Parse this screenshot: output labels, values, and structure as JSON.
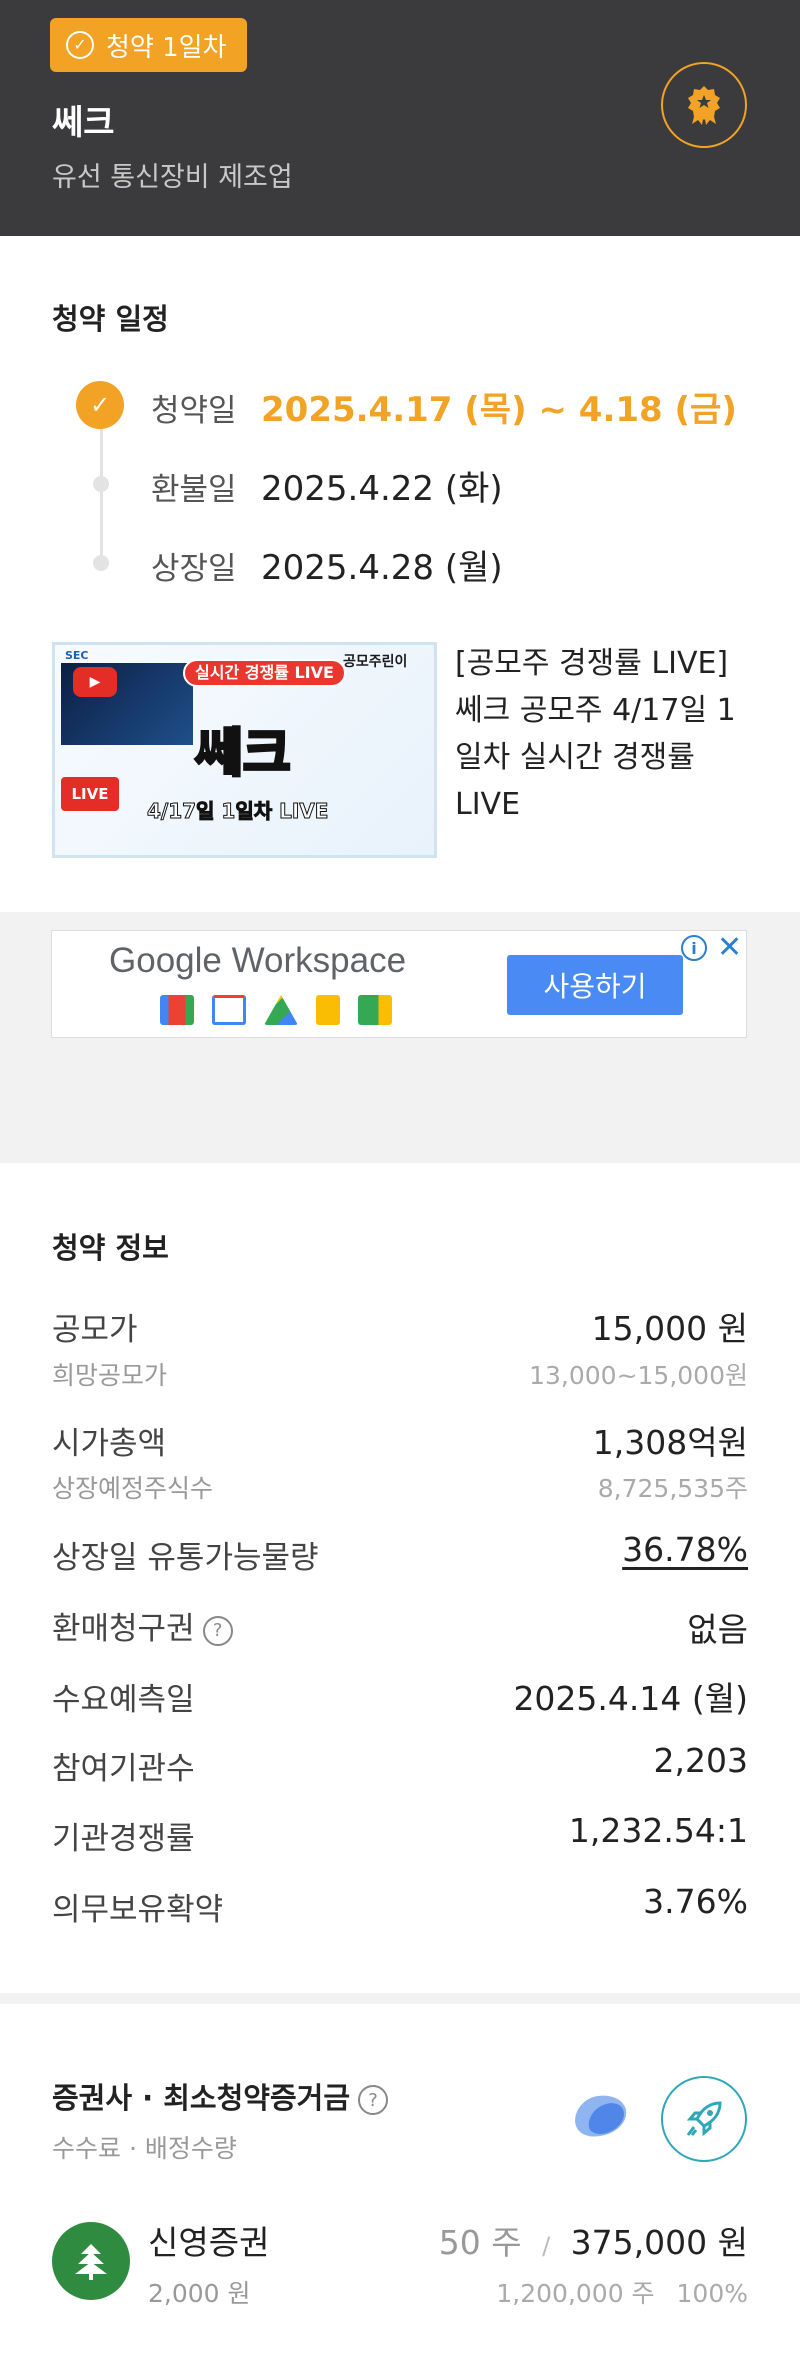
{
  "header": {
    "badge": "청약 1일차",
    "company": "쎄크",
    "industry": "유선 통신장비 제조업",
    "award_icon": "award-ribbon-icon"
  },
  "schedule": {
    "title": "청약 일정",
    "items": [
      {
        "label": "청약일",
        "date": "2025.4.17 (목) ~ 4.18 (금)"
      },
      {
        "label": "환불일",
        "date": "2025.4.22 (화)"
      },
      {
        "label": "상장일",
        "date": "2025.4.28 (월)"
      }
    ]
  },
  "video": {
    "title": "[공모주 경쟁률 LIVE] 쎄크 공모주 4/17일 1일차 실시간 경쟁률 LIVE",
    "thumb": {
      "channel": "공모주린이",
      "banner": "실시간 경쟁률 LIVE",
      "name": "쎄크",
      "sub": "4/17일 1일차 LIVE",
      "live": "LIVE",
      "sec_logo": "SEC"
    }
  },
  "ad": {
    "brand_google": "Google",
    "brand_workspace": "Workspace",
    "cta": "사용하기",
    "info": "i",
    "close": "✕"
  },
  "info": {
    "title": "청약 정보",
    "offer_price_label": "공모가",
    "offer_price": "15,000 원",
    "desired_price_label": "희망공모가",
    "desired_price": "13,000~15,000원",
    "market_cap_label": "시가총액",
    "market_cap": "1,308억원",
    "shares_label": "상장예정주식수",
    "shares": "8,725,535주",
    "float_label": "상장일 유통가능물량",
    "float": "36.78%",
    "putback_label": "환매청구권",
    "putback": "없음",
    "forecast_label": "수요예측일",
    "forecast": "2025.4.14 (월)",
    "institutions_label": "참여기관수",
    "institutions": "2,203",
    "competition_label": "기관경쟁률",
    "competition": "1,232.54:1",
    "lockup_label": "의무보유확약",
    "lockup": "3.76%"
  },
  "broker": {
    "title": "증권사 · 최소청약증거금",
    "subtitle": "수수료 · 배정수량",
    "help": "?",
    "name": "신영증권",
    "fee": "2,000 원",
    "min_shares": "50 주",
    "separator": "/",
    "min_deposit": "375,000 원",
    "allotted": "1,200,000 주",
    "ratio": "100%"
  },
  "colors": {
    "accent": "#f2a224",
    "header_bg": "#3b3b3d",
    "teal": "#2ea8b8",
    "broker_green": "#2e8b3f"
  }
}
